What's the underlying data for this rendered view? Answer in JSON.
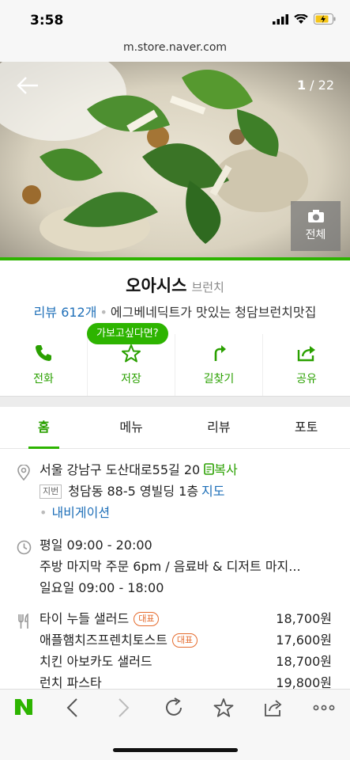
{
  "status": {
    "time": "3:58"
  },
  "browser": {
    "url": "m.store.naver.com"
  },
  "hero": {
    "counter_current": "1",
    "counter_sep": " / ",
    "counter_total": "22",
    "all_label": "전체"
  },
  "store": {
    "name": "오아시스",
    "category": "브런치",
    "review_label": "리뷰 612개",
    "description": "에그베네딕트가 맛있는 청담브런치맛집"
  },
  "wish_bubble": "가보고싶다면?",
  "actions": [
    {
      "label": "전화",
      "icon": "phone-icon"
    },
    {
      "label": "저장",
      "icon": "star-icon"
    },
    {
      "label": "길찾기",
      "icon": "directions-icon"
    },
    {
      "label": "공유",
      "icon": "share-icon"
    }
  ],
  "tabs": [
    "홈",
    "메뉴",
    "리뷰",
    "포토"
  ],
  "address": {
    "road": "서울 강남구 도산대로55길 20",
    "copy_label": "복사",
    "jibun_tag": "지번",
    "jibun": "청담동 88-5 영빌딩 1층",
    "map_label": "지도",
    "navi_label": "내비게이션"
  },
  "hours": {
    "weekday": "평일 09:00 - 20:00",
    "note": "주방 마지막 주문 6pm / 음료바 & 디저트 마지...",
    "sunday": "일요일 09:00 - 18:00"
  },
  "menu": [
    {
      "name": "타이 누들 샐러드",
      "rep": "대표",
      "price": "18,700원"
    },
    {
      "name": "애플햄치즈프렌치토스트",
      "rep": "대표",
      "price": "17,600원"
    },
    {
      "name": "치킨 아보카도 샐러드",
      "rep": "",
      "price": "18,700원"
    },
    {
      "name": "런치 파스타",
      "rep": "",
      "price": "19,800원"
    }
  ],
  "colors": {
    "naver_green": "#2db400",
    "link_blue": "#1e6fb8",
    "rep_orange": "#e56b2d"
  }
}
